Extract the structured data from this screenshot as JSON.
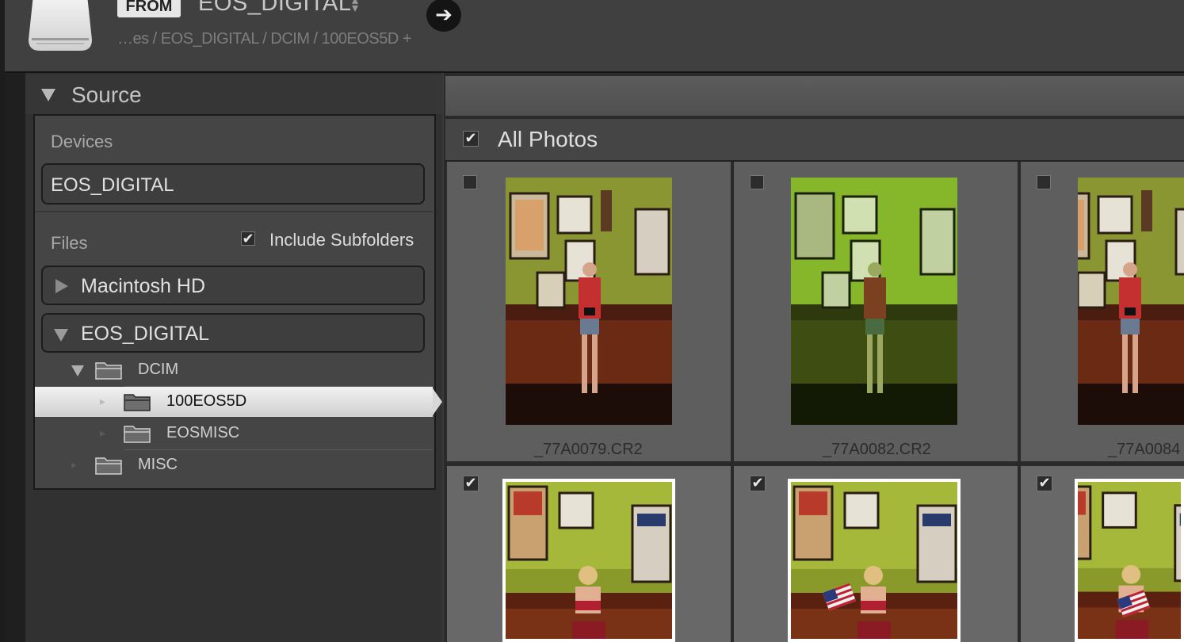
{
  "header": {
    "from_badge": "FROM",
    "source_name": "EOS_DIGITAL",
    "source_arrows_icon": "up-down-arrows-icon",
    "go_icon": "arrow-right-icon",
    "path": "…es / EOS_DIGITAL / DCIM / 100EOS5D +"
  },
  "source_panel": {
    "title": "Source",
    "devices_label": "Devices",
    "device_name": "EOS_DIGITAL",
    "files_label": "Files",
    "include_subfolders_label": "Include Subfolders",
    "include_subfolders_checked": true,
    "volumes": [
      {
        "label": "Macintosh HD",
        "expanded": false
      },
      {
        "label": "EOS_DIGITAL",
        "expanded": true
      }
    ],
    "folders": [
      {
        "label": "DCIM",
        "depth": 1,
        "expanded": true,
        "selected": false
      },
      {
        "label": "100EOS5D",
        "depth": 2,
        "expanded": false,
        "selected": true
      },
      {
        "label": "EOSMISC",
        "depth": 2,
        "expanded": false,
        "selected": false
      },
      {
        "label": "MISC",
        "depth": 1,
        "expanded": false,
        "selected": false
      }
    ]
  },
  "grid": {
    "all_photos_label": "All Photos",
    "all_photos_checked": true,
    "photos": [
      {
        "filename": "_77A0079.CR2",
        "checked": false
      },
      {
        "filename": "_77A0082.CR2",
        "checked": false
      },
      {
        "filename": "_77A0084",
        "checked": false
      },
      {
        "filename": "",
        "checked": true
      },
      {
        "filename": "",
        "checked": true
      },
      {
        "filename": "",
        "checked": true
      }
    ]
  },
  "colors": {
    "panel_bg": "#313131",
    "selection": "#e6e6e6",
    "grid_cell": "#5e5e5e"
  }
}
